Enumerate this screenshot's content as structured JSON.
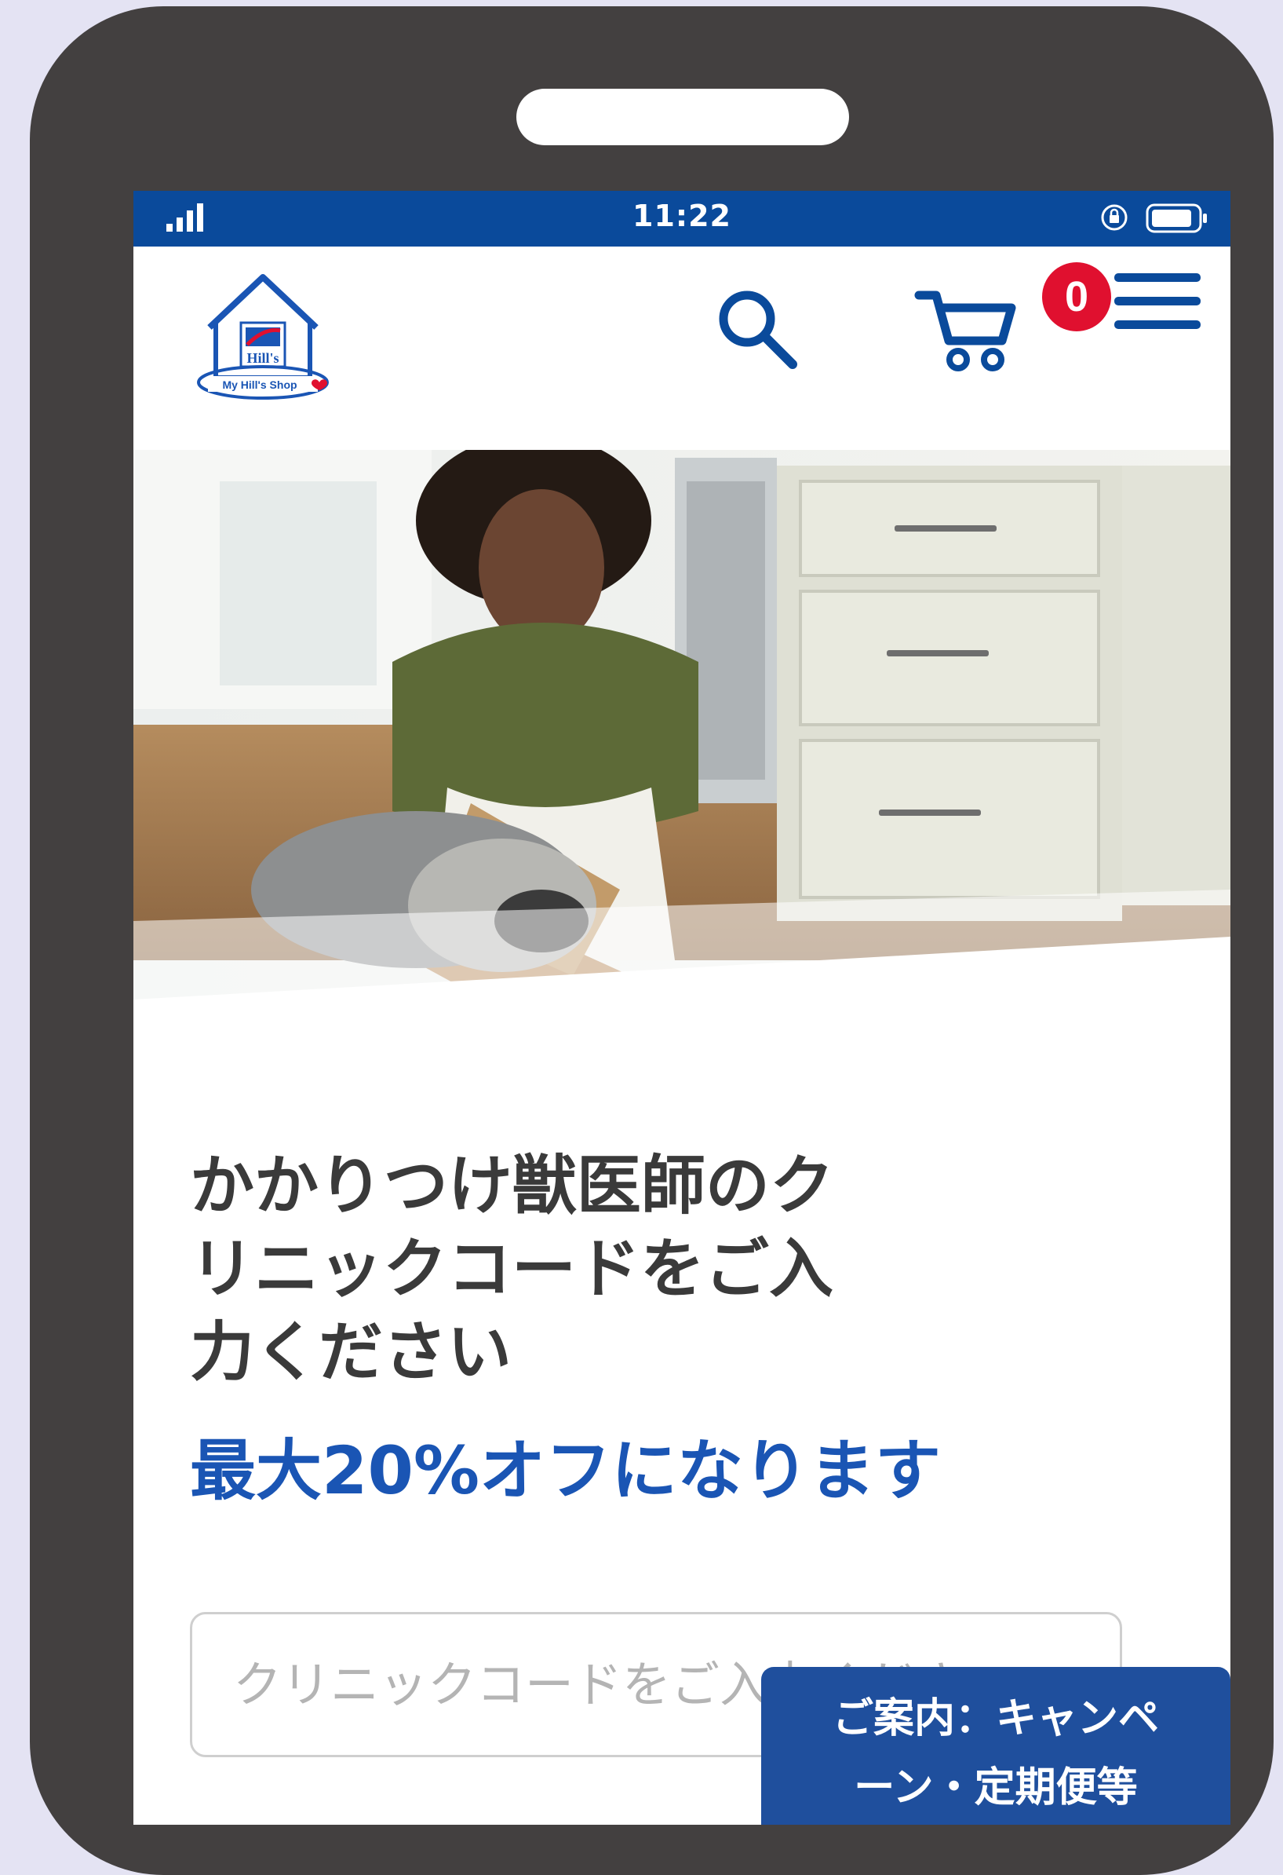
{
  "status_bar": {
    "time": "11:22",
    "background_color": "#0a4a9b",
    "icons": [
      "signal-icon",
      "rotation-lock-icon",
      "battery-icon"
    ]
  },
  "header": {
    "logo": {
      "brand_text": "Hill's",
      "tagline": "My Hill's Shop"
    },
    "search_icon": "search-icon",
    "cart": {
      "icon": "cart-icon",
      "count": "0",
      "badge_color": "#e0102f"
    },
    "menu_icon": "menu-icon",
    "accent_color": "#1a55b4"
  },
  "main": {
    "heading_lines": [
      "かかりつけ獣医師のク",
      "リニックコードをご入",
      "力ください"
    ],
    "subheading": "最大20%オフになります",
    "clinic_code_input": {
      "placeholder": "クリニックコードをご入力ください",
      "value": ""
    }
  },
  "popup": {
    "lines": [
      "ご案内：キャンペ",
      "ーン・定期便等"
    ],
    "background_color": "#1f4f9d"
  }
}
